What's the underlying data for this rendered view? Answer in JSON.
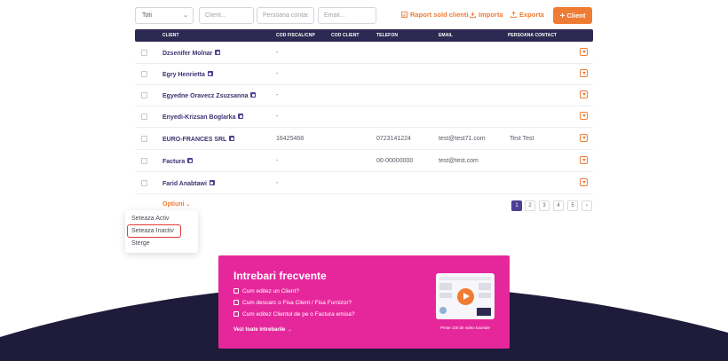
{
  "toolbar": {
    "filter_select": "Toti",
    "client_placeholder": "Client...",
    "contact_placeholder": "Persoana contact...",
    "email_placeholder": "Email...",
    "report_label": "Raport sold clienti",
    "import_label": "Importa",
    "export_label": "Exporta",
    "add_client_label": "Client"
  },
  "table": {
    "headers": [
      "CLIENT",
      "COD FISCAL/CNP",
      "COD CLIENT",
      "TELEFON",
      "EMAIL",
      "PERSOANA CONTACT"
    ],
    "rows": [
      {
        "client": "Dzsenifer Molnar",
        "cod_fiscal": "-",
        "cod_client": "",
        "telefon": "",
        "email": "",
        "contact": ""
      },
      {
        "client": "Egry Henrietta",
        "cod_fiscal": "-",
        "cod_client": "",
        "telefon": "",
        "email": "",
        "contact": ""
      },
      {
        "client": "Egyedne Oravecz Zsuzsanna",
        "cod_fiscal": "-",
        "cod_client": "",
        "telefon": "",
        "email": "",
        "contact": ""
      },
      {
        "client": "Enyedi-Krizsan Boglarka",
        "cod_fiscal": "-",
        "cod_client": "",
        "telefon": "",
        "email": "",
        "contact": ""
      },
      {
        "client": "EURO-FRANCES SRL",
        "cod_fiscal": "16425468",
        "cod_client": "",
        "telefon": "0723141224",
        "email": "test@test71.com",
        "contact": "Test Test"
      },
      {
        "client": "Factura",
        "cod_fiscal": "-",
        "cod_client": "",
        "telefon": "00-00000000",
        "email": "test@test.com",
        "contact": ""
      },
      {
        "client": "Farid Anabtawi",
        "cod_fiscal": "-",
        "cod_client": "",
        "telefon": "",
        "email": "",
        "contact": ""
      }
    ]
  },
  "options": {
    "label": "Optiuni",
    "menu": [
      "Seteaza Activ",
      "Seteaza Inactiv",
      "Sterge"
    ],
    "highlighted": "Seteaza Inactiv"
  },
  "pagination": {
    "pages": [
      "1",
      "2",
      "3",
      "4",
      "5"
    ],
    "current": "1",
    "next": "›"
  },
  "faq": {
    "title": "Intrebari frecvente",
    "questions": [
      "Cum editez un Client?",
      "Cum descarc o Fisa Client / Fisa Furnizor?",
      "Cum editez Clientul de pe o Factura emisa?"
    ],
    "all_link": "Vezi toate intrebarile",
    "video_caption": "Peste 100 de video tutoriale"
  },
  "colors": {
    "accent": "#f07b33",
    "header": "#2c2a52",
    "faq_bg": "#e6279c",
    "wave": "#1f1b3a",
    "highlight_border": "#e03a3a"
  }
}
